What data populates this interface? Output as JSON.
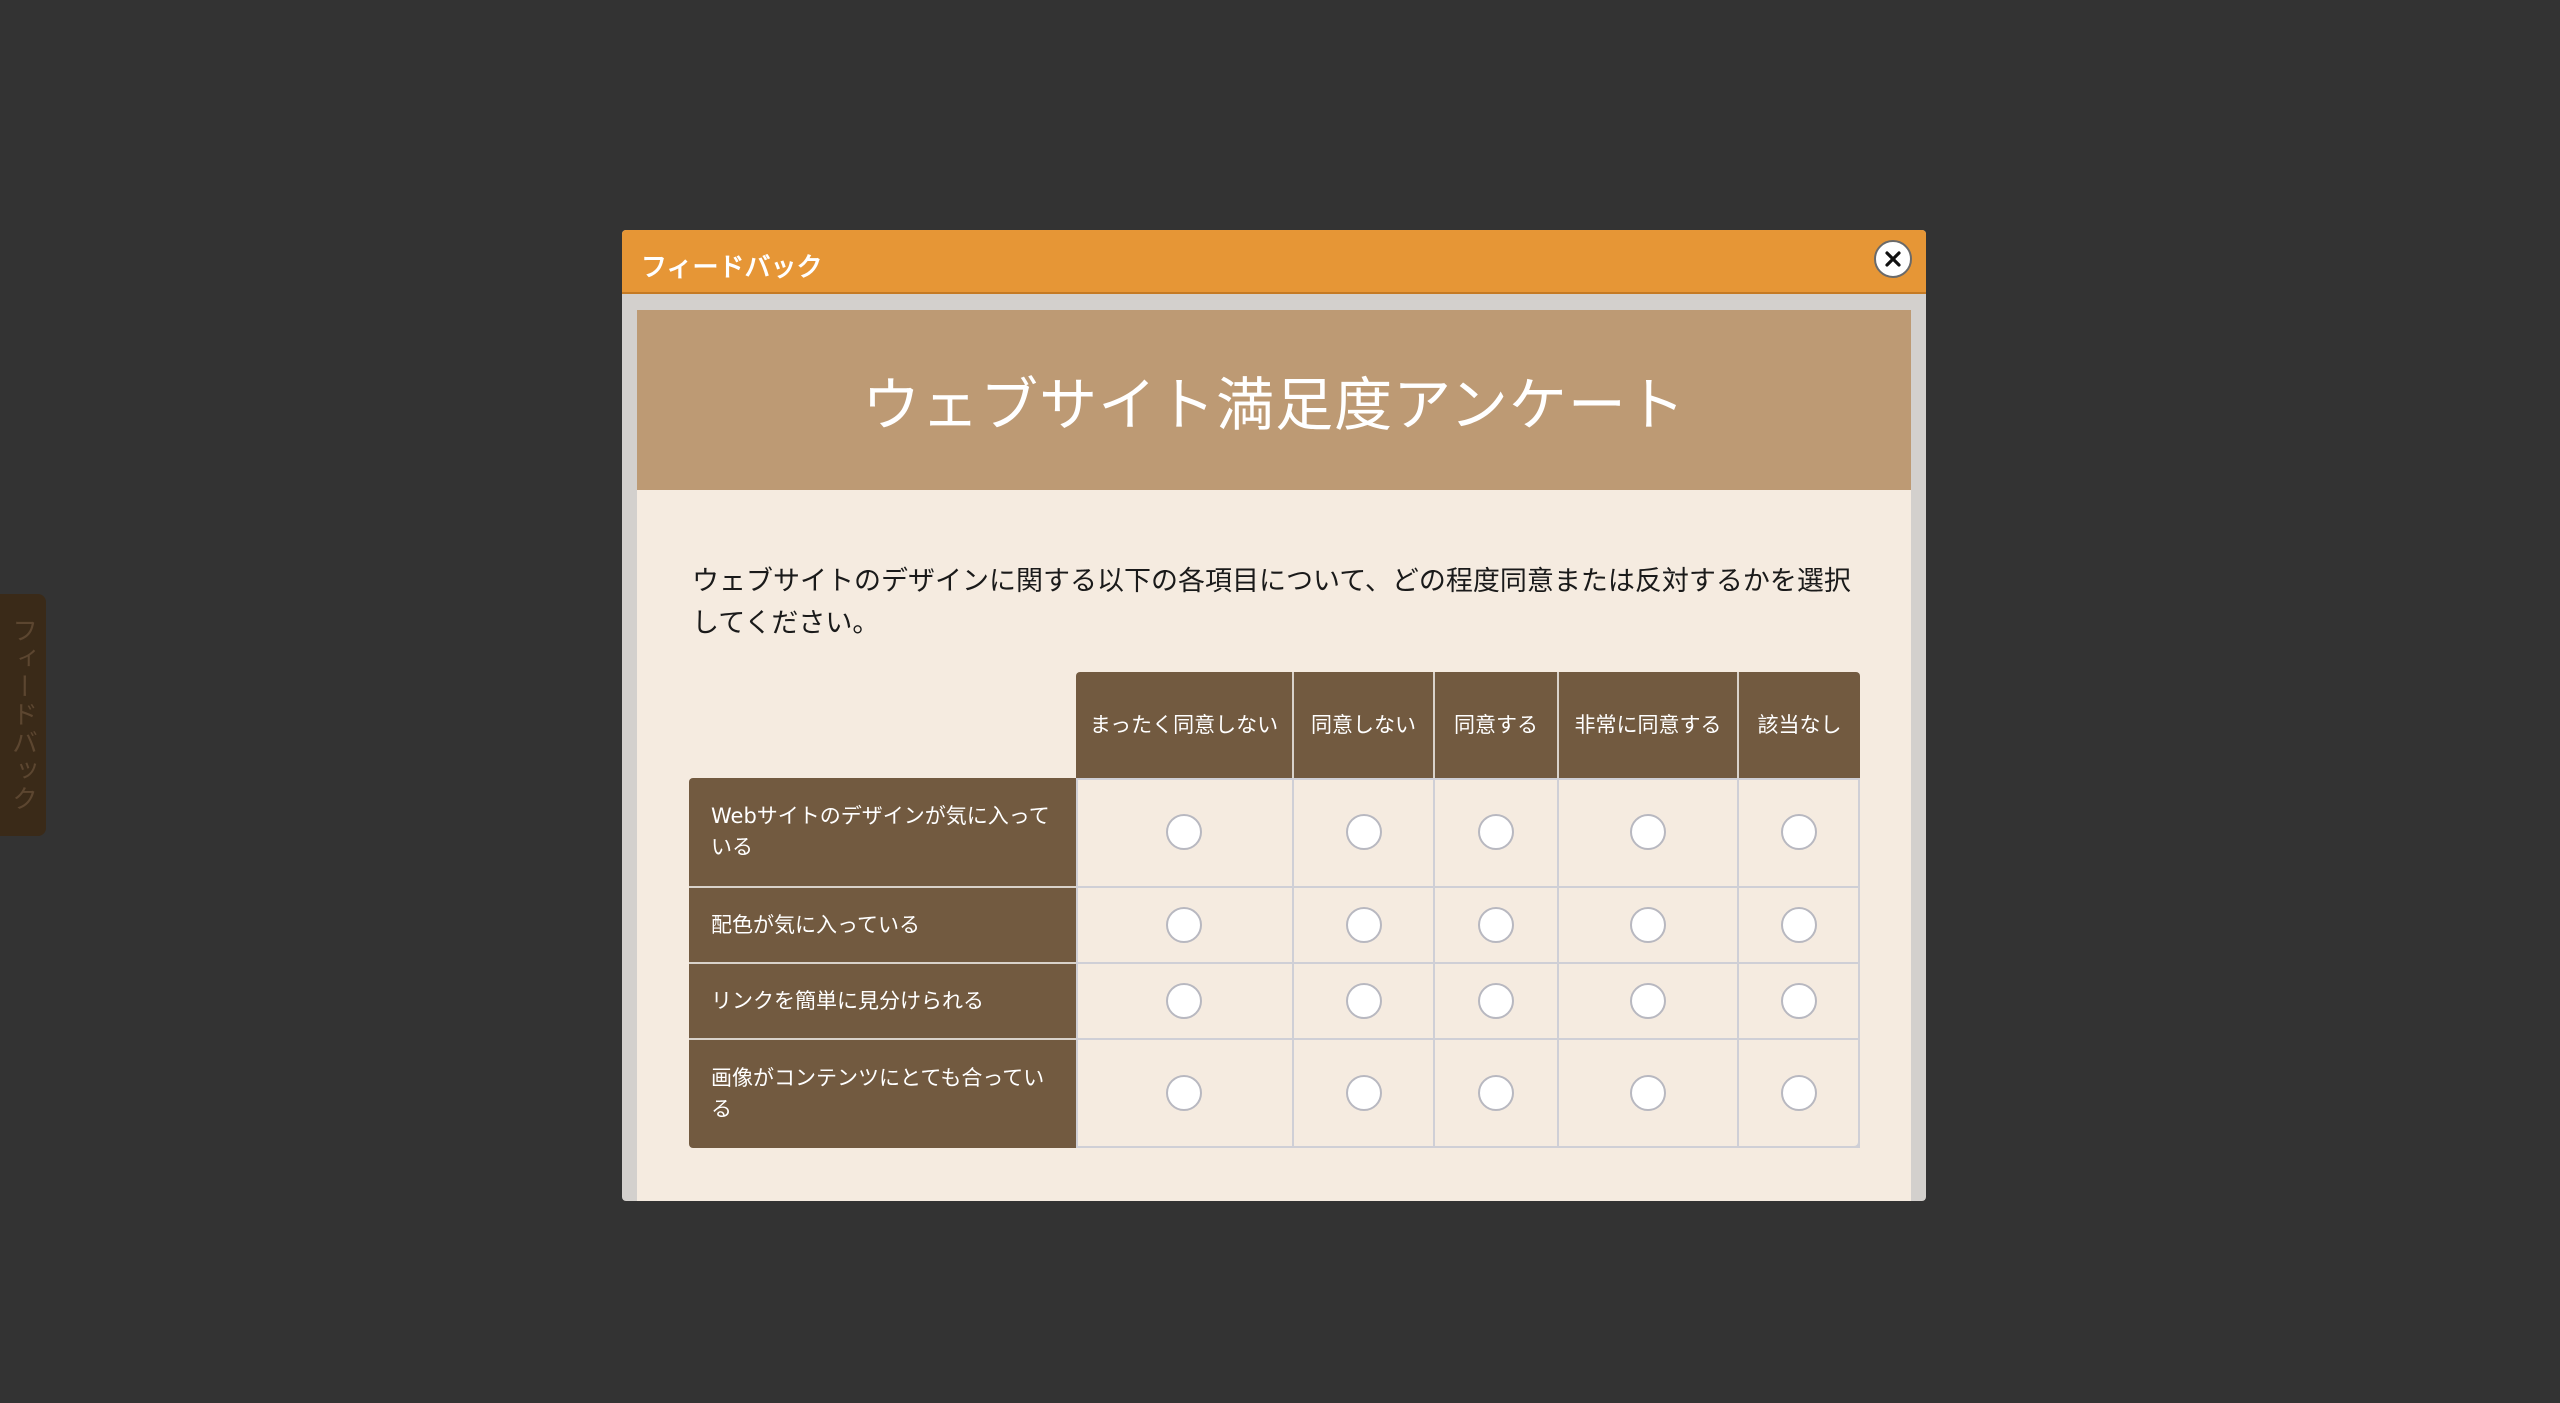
{
  "side_tab": {
    "label": "フィードバック"
  },
  "dialog": {
    "title": "フィードバック",
    "close_label": "✕",
    "banner_title": "ウェブサイト満足度アンケート",
    "instructions": "ウェブサイトのデザインに関する以下の各項目について、どの程度同意または反対するかを選択してください。"
  },
  "matrix": {
    "columns": [
      "まったく同意しない",
      "同意しない",
      "同意する",
      "非常に同意する",
      "該当なし"
    ],
    "rows": [
      "Webサイトのデザインが気に入っている",
      "配色が気に入っている",
      "リンクを簡単に見分けられる",
      "画像がコンテンツにとても合っている"
    ]
  },
  "colors": {
    "backdrop": "#333333",
    "titlebar": "#e69636",
    "banner": "#bd9a74",
    "header_cell": "#725a40",
    "content_bg": "#f5ebe0"
  }
}
